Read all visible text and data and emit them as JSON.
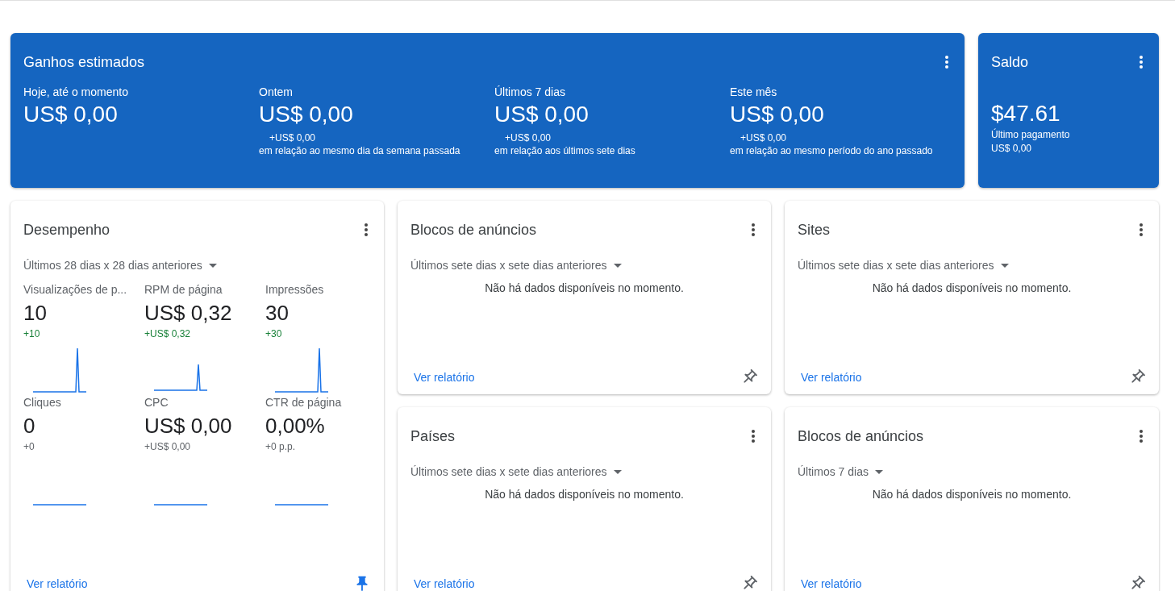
{
  "earnings": {
    "title": "Ganhos estimados",
    "periods": [
      {
        "label": "Hoje, até o momento",
        "value": "US$ 0,00"
      },
      {
        "label": "Ontem",
        "value": "US$ 0,00",
        "change": "+US$ 0,00",
        "comparison": "em relação ao mesmo dia da semana passada"
      },
      {
        "label": "Últimos 7 dias",
        "value": "US$ 0,00",
        "change": "+US$ 0,00",
        "comparison": "em relação aos últimos sete dias"
      },
      {
        "label": "Este mês",
        "value": "US$ 0,00",
        "change": "+US$ 0,00",
        "comparison": "em relação ao mesmo período do ano passado"
      }
    ]
  },
  "balance": {
    "title": "Saldo",
    "value": "$47.61",
    "last_payment_label": "Último pagamento",
    "last_payment": "US$ 0,00"
  },
  "performance": {
    "title": "Desempenho",
    "range": "Últimos 28 dias x 28 dias anteriores",
    "metrics": [
      {
        "label": "Visualizações de p...",
        "value": "10",
        "change": "+10",
        "positive": true
      },
      {
        "label": "RPM de página",
        "value": "US$ 0,32",
        "change": "+US$ 0,32",
        "positive": true
      },
      {
        "label": "Impressões",
        "value": "30",
        "change": "+30",
        "positive": true
      },
      {
        "label": "Cliques",
        "value": "0",
        "change": "+0",
        "positive": false
      },
      {
        "label": "CPC",
        "value": "US$ 0,00",
        "change": "+US$ 0,00",
        "positive": false
      },
      {
        "label": "CTR de página",
        "value": "0,00%",
        "change": "+0 p.p.",
        "positive": false
      }
    ],
    "link": "Ver relatório",
    "pinned": true
  },
  "cards": [
    {
      "title": "Blocos de anúncios",
      "range": "Últimos sete dias x sete dias anteriores",
      "message": "Não há dados disponíveis no momento.",
      "link": "Ver relatório",
      "pinned": false
    },
    {
      "title": "Sites",
      "range": "Últimos sete dias x sete dias anteriores",
      "message": "Não há dados disponíveis no momento.",
      "link": "Ver relatório",
      "pinned": false
    },
    {
      "title": "Países",
      "range": "Últimos sete dias x sete dias anteriores",
      "message": "Não há dados disponíveis no momento.",
      "link": "Ver relatório",
      "pinned": false
    },
    {
      "title": "Blocos de anúncios",
      "range": "Últimos 7 dias",
      "message": "Não há dados disponíveis no momento.",
      "link": "Ver relatório",
      "pinned": false
    }
  ]
}
